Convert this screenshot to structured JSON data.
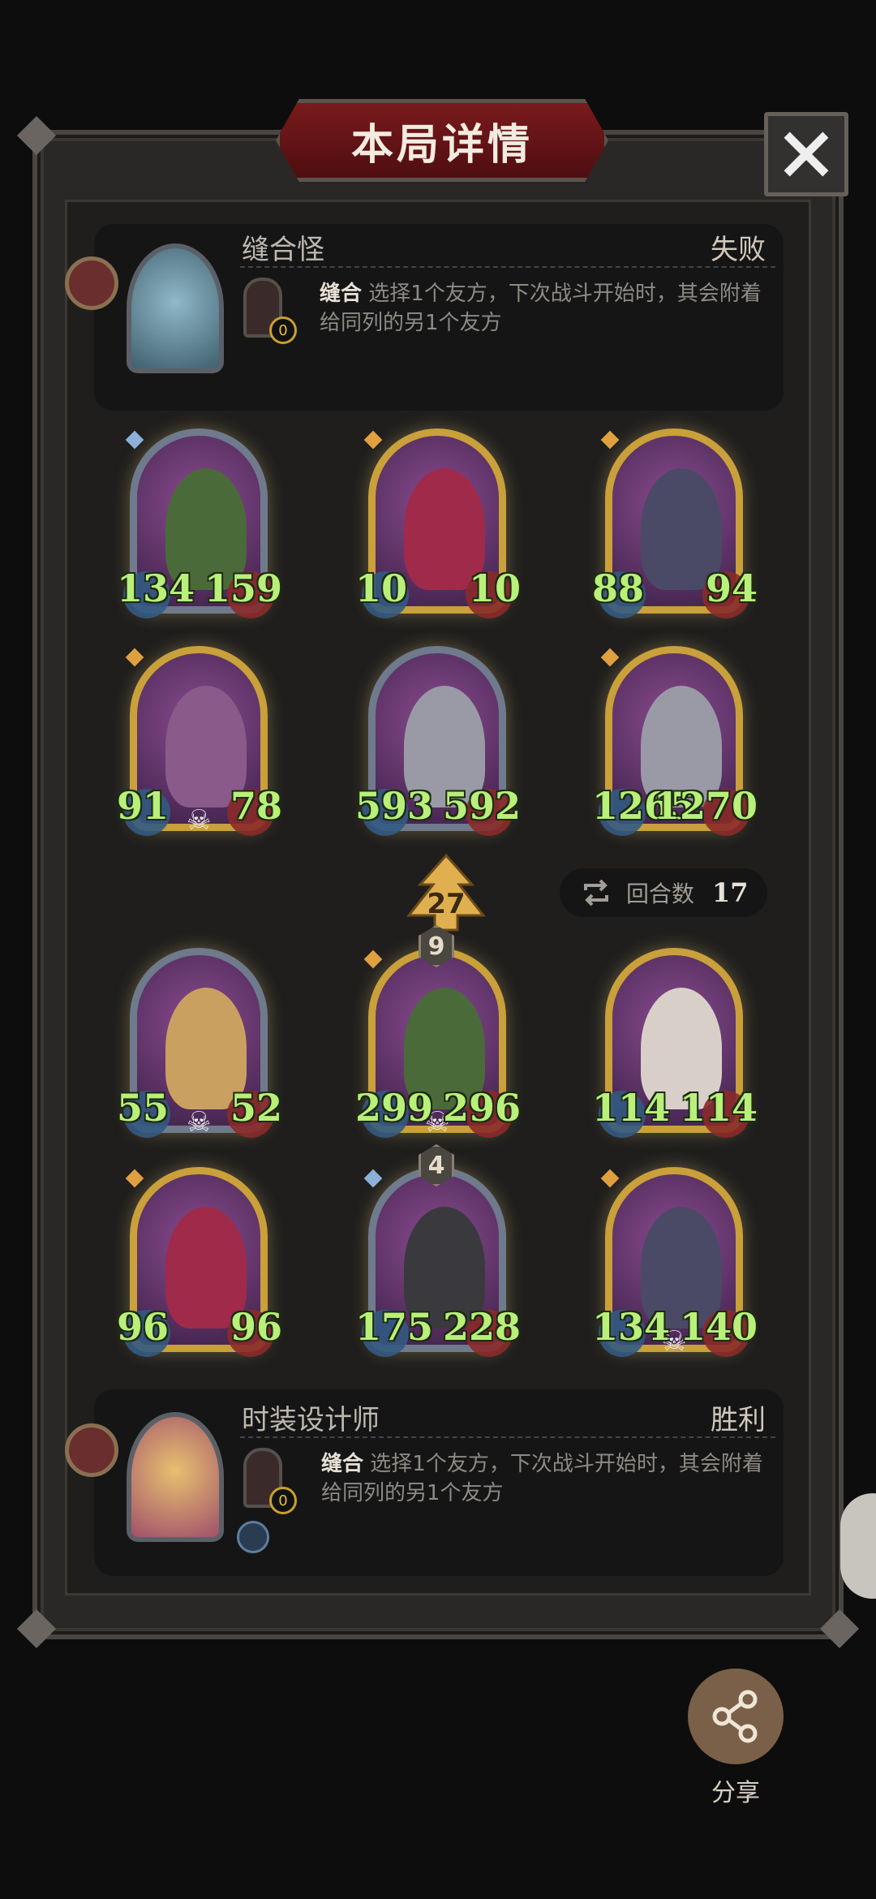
{
  "dialog": {
    "title": "本局详情"
  },
  "opponent": {
    "name": "缝合怪",
    "result": "失败",
    "skill_name": "缝合",
    "skill_desc": "选择1个友方，下次战斗开始时，其会附着给同列的另1个友方",
    "badge_count": "0"
  },
  "player": {
    "name": "时装设计师",
    "result": "胜利",
    "skill_name": "缝合",
    "skill_desc": "选择1个友方，下次战斗开始时，其会附着给同列的另1个友方",
    "badge_count": "0"
  },
  "opponent_units": [
    {
      "atk": "134",
      "hp": "159"
    },
    {
      "atk": "10",
      "hp": "10"
    },
    {
      "atk": "88",
      "hp": "94"
    },
    {
      "atk": "91",
      "hp": "78"
    },
    {
      "atk": "593",
      "hp": "592"
    },
    {
      "atk": "1265",
      "hp": "1270"
    }
  ],
  "player_units": [
    {
      "atk": "55",
      "hp": "52"
    },
    {
      "atk": "299",
      "hp": "296",
      "level": "9"
    },
    {
      "atk": "114",
      "hp": "114"
    },
    {
      "atk": "96",
      "hp": "96"
    },
    {
      "atk": "175",
      "hp": "228",
      "level": "4"
    },
    {
      "atk": "134",
      "hp": "140"
    }
  ],
  "attack_indicator": "27",
  "rounds": {
    "label": "回合数",
    "value": "17"
  },
  "share": {
    "label": "分享"
  },
  "colors": {
    "stat_green": "#b8f07a",
    "title_red": "#7a1a1c",
    "gold_frame": "#c49a34"
  }
}
